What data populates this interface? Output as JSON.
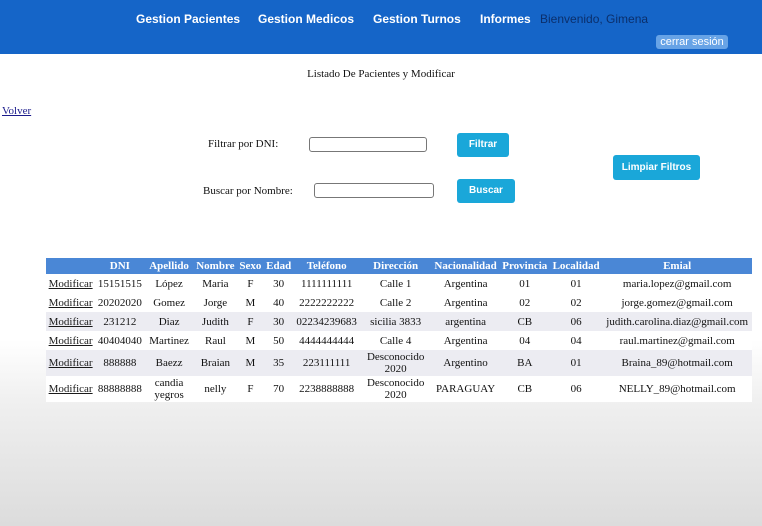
{
  "nav": {
    "items": [
      "Gestion Pacientes",
      "Gestion Medicos",
      "Gestion Turnos",
      "Informes"
    ],
    "welcome": "Bienvenido, Gimena",
    "logout": "cerrar sesión"
  },
  "page": {
    "title": "Listado De Pacientes y Modificar",
    "back": "Volver"
  },
  "filters": {
    "dni_label": "Filtrar por DNI:",
    "dni_value": "",
    "filter_button": "Filtrar",
    "name_label": "Buscar por Nombre:",
    "name_value": "",
    "search_button": "Buscar",
    "clear_button": "Limpiar Filtros"
  },
  "table": {
    "headers": [
      "",
      "DNI",
      "Apellido",
      "Nombre",
      "Sexo",
      "Edad",
      "Teléfono",
      "Dirección",
      "Nacionalidad",
      "Provincia",
      "Localidad",
      "Emial"
    ],
    "rows": [
      [
        "Modificar",
        "15151515",
        "López",
        "Maria",
        "F",
        "30",
        "1111111111",
        "Calle 1",
        "Argentina",
        "01",
        "01",
        "maria.lopez@gmail.com"
      ],
      [
        "Modificar",
        "20202020",
        "Gomez",
        "Jorge",
        "M",
        "40",
        "2222222222",
        "Calle 2",
        "Argentina",
        "02",
        "02",
        "jorge.gomez@gmail.com"
      ],
      [
        "Modificar",
        "231212",
        "Diaz",
        "Judith",
        "F",
        "30",
        "02234239683",
        "sicilia 3833",
        "argentina",
        "CB",
        "06",
        "judith.carolina.diaz@gmail.com"
      ],
      [
        "Modificar",
        "40404040",
        "Martinez",
        "Raul",
        "M",
        "50",
        "4444444444",
        "Calle 4",
        "Argentina",
        "04",
        "04",
        "raul.martinez@gmail.com"
      ],
      [
        "Modificar",
        "888888",
        "Baezz",
        "Braian",
        "M",
        "35",
        "223111111",
        "Desconocido 2020",
        "Argentino",
        "BA",
        "01",
        "Braina_89@hotmail.com"
      ],
      [
        "Modificar",
        "88888888",
        "candia yegros",
        "nelly",
        "F",
        "70",
        "2238888888",
        "Desconocido 2020",
        "PARAGUAY",
        "CB",
        "06",
        "NELLY_89@hotmail.com"
      ]
    ]
  }
}
